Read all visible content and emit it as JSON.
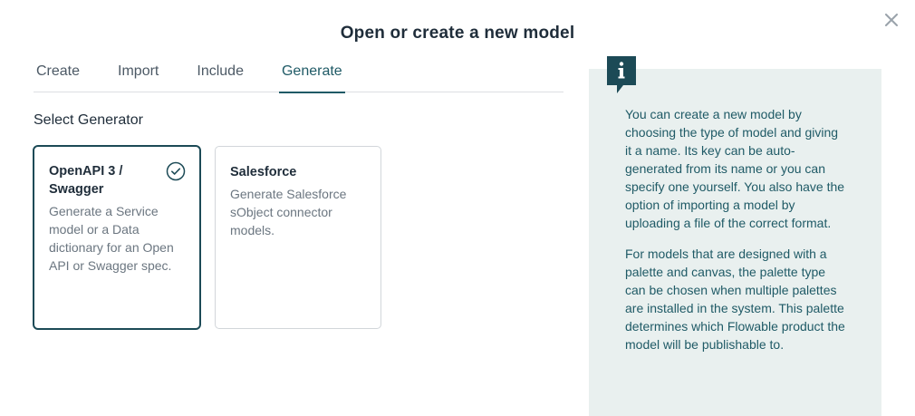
{
  "dialog": {
    "title": "Open or create a new model"
  },
  "tabs": [
    {
      "label": "Create",
      "active": false
    },
    {
      "label": "Import",
      "active": false
    },
    {
      "label": "Include",
      "active": false
    },
    {
      "label": "Generate",
      "active": true
    }
  ],
  "section": {
    "label": "Select Generator"
  },
  "cards": [
    {
      "title": "OpenAPI 3 / Swagger",
      "description": "Generate a Service model or a Data dictionary for an Open API or Swagger spec.",
      "selected": true
    },
    {
      "title": "Salesforce",
      "description": "Generate Salesforce sObject connector models.",
      "selected": false
    }
  ],
  "info": {
    "paragraphs": [
      "You can create a new model by choosing the type of model and giving it a name. Its key can be auto-generated from its name or you can specify one yourself. You also have the option of importing a model by uploading a file of the correct format.",
      "For models that are designed with a palette and canvas, the palette type can be chosen when multiple palettes are installed in the system. This palette determines which Flowable product the model will be publishable to."
    ]
  },
  "colors": {
    "accent": "#1f5a66",
    "selected_border": "#1c4a56",
    "info_background": "#e9f0ef",
    "info_badge": "#1c4a56",
    "close_icon": "#9aa3ab"
  },
  "icons": {
    "close": "close-icon",
    "selected": "check-circle-icon",
    "info": "info-icon"
  }
}
